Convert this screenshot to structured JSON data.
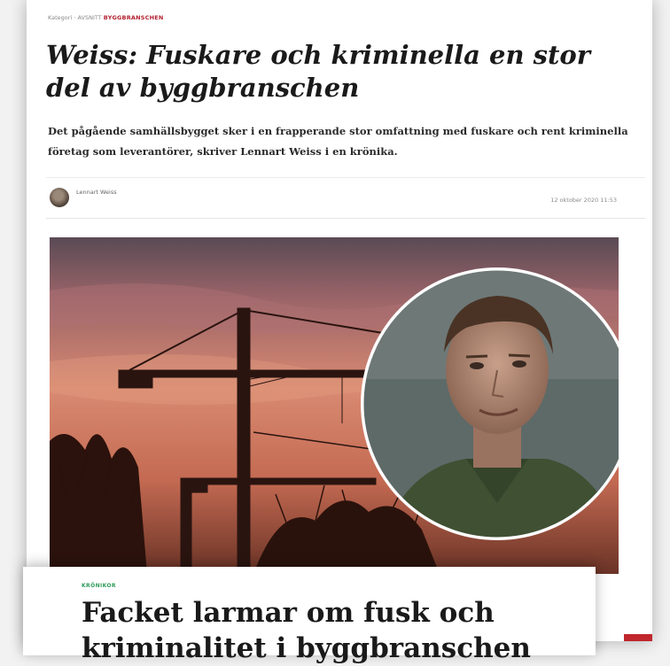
{
  "article_back": {
    "breadcrumb_prefix": "Kategori",
    "breadcrumb_mid": "AVSNITT",
    "breadcrumb_tag": "BYGGBRANSCHEN",
    "headline": "Weiss: Fuskare och kriminella en stor del av byggbranschen",
    "lede": "Det pågående samhällsbygget sker i en frapperande stor omfattning med fuskare och rent kriminella företag som leverantörer, skriver Lennart Weiss i en krönika.",
    "author_name": "Lennart Weiss",
    "date": "12 oktober 2020 11:53"
  },
  "article_front": {
    "tag": "KRÖNIKOR",
    "headline": "Facket larmar om fusk och kriminalitet i byggbranschen"
  },
  "colors": {
    "accent_red": "#b3202f",
    "tag_green": "#2f9a5a"
  }
}
